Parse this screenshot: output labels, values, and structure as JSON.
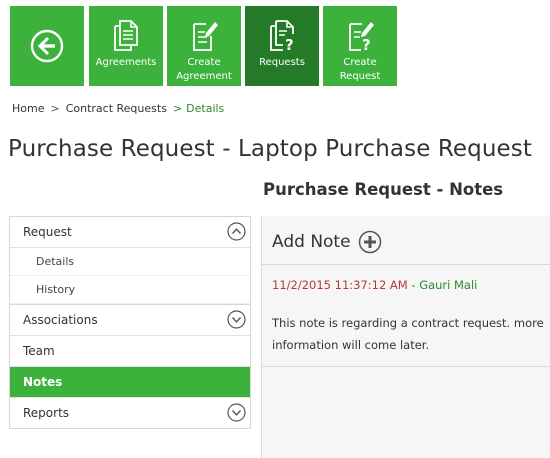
{
  "toolbar": {
    "back": {
      "icon": "back-arrow-icon"
    },
    "agreements": {
      "label": "Agreements",
      "icon": "documents-icon"
    },
    "create_agreement": {
      "label": "Create\nAgreement",
      "icon": "document-pencil-icon"
    },
    "requests": {
      "label": "Requests",
      "icon": "documents-question-icon"
    },
    "create_request": {
      "label": "Create\nRequest",
      "icon": "document-question-pencil-icon"
    },
    "colors": {
      "tile": "#3cb23c",
      "active": "#247a27"
    }
  },
  "breadcrumb": {
    "home": "Home",
    "sep1": ">",
    "contract_requests": "Contract Requests",
    "sep2": ">",
    "current": "Details"
  },
  "page": {
    "title": "Purchase Request - Laptop Purchase Request",
    "section_title": "Purchase Request - Notes"
  },
  "nav": {
    "request": {
      "label": "Request",
      "toggle_icon": "chevron-up-circle-icon"
    },
    "details": "Details",
    "history": "History",
    "associations": {
      "label": "Associations",
      "toggle_icon": "chevron-down-circle-icon"
    },
    "team": "Team",
    "notes": "Notes",
    "reports": {
      "label": "Reports",
      "toggle_icon": "chevron-down-circle-icon"
    }
  },
  "notes": {
    "add_label": "Add Note",
    "add_icon": "plus-circle-icon",
    "items": [
      {
        "timestamp": "11/2/2015 11:37:12 AM",
        "separator": " - ",
        "author": "Gauri Mali",
        "text": "This note is regarding a contract request. more information will come later."
      }
    ]
  }
}
